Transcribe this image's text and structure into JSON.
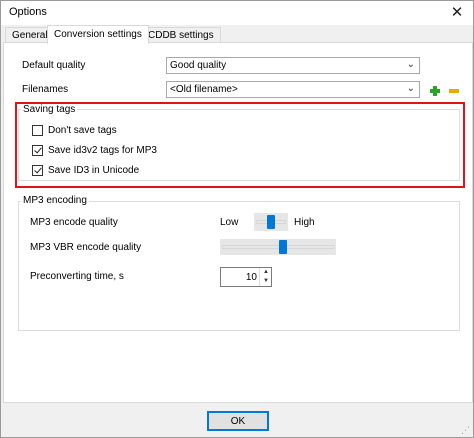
{
  "window": {
    "title": "Options",
    "close_glyph": "✕"
  },
  "tabs": [
    {
      "label": "General"
    },
    {
      "label": "Conversion settings"
    },
    {
      "label": "CDDB settings"
    }
  ],
  "conversion": {
    "default_quality_label": "Default quality",
    "default_quality_value": "Good quality",
    "filenames_label": "Filenames",
    "filenames_value": "<Old filename>",
    "chevron": "⌄"
  },
  "saving_tags": {
    "title": "Saving tags",
    "options": [
      {
        "label": "Don't save tags",
        "checked": false
      },
      {
        "label": "Save id3v2 tags for MP3",
        "checked": true
      },
      {
        "label": "Save ID3 in Unicode",
        "checked": true
      }
    ]
  },
  "mp3_encoding": {
    "title": "MP3 encoding",
    "encode_quality_label": "MP3 encode quality",
    "low_label": "Low",
    "high_label": "High",
    "encode_quality_level": 0.5,
    "vbr_label": "MP3 VBR encode quality",
    "vbr_level": 0.55,
    "preconverting_label": "Preconverting time, s",
    "preconverting_value": "10"
  },
  "footer": {
    "ok_label": "OK"
  },
  "colors": {
    "highlight": "#e0121b",
    "accent": "#0078d7",
    "add_icon": "#2aa52a",
    "remove_icon": "#f0a500"
  },
  "icons": {
    "add": "plus-icon",
    "remove": "minus-icon",
    "close": "close-icon"
  }
}
